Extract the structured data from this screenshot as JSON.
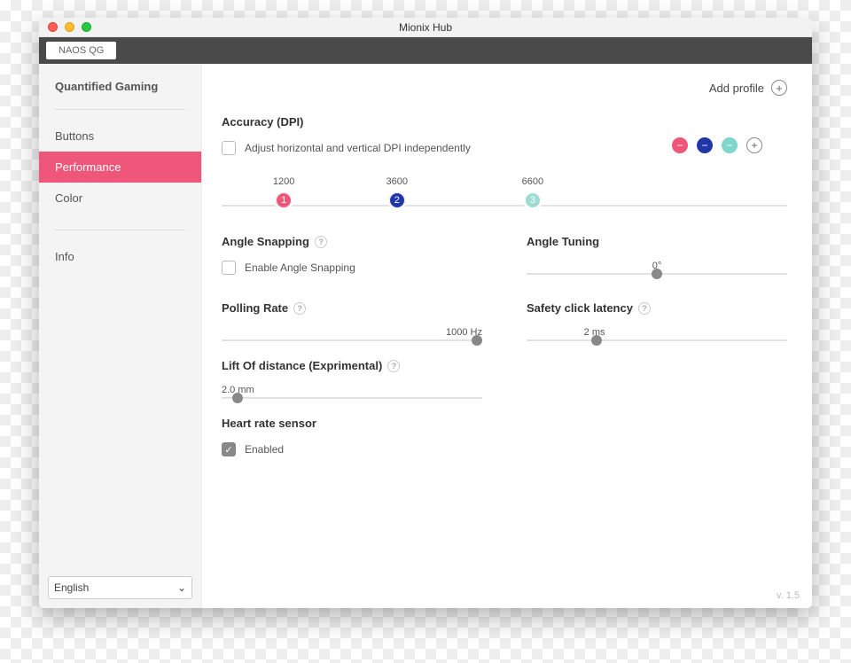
{
  "window": {
    "title": "Mionix Hub"
  },
  "devicebar": {
    "device": "NAOS QG"
  },
  "sidebar": {
    "header": "Quantified Gaming",
    "items": [
      {
        "label": "Buttons",
        "active": false
      },
      {
        "label": "Performance",
        "active": true
      },
      {
        "label": "Color",
        "active": false
      }
    ],
    "info": "Info",
    "language": "English"
  },
  "topbar": {
    "add_profile": "Add profile"
  },
  "accuracy": {
    "title": "Accuracy (DPI)",
    "independent_label": "Adjust horizontal and vertical DPI independently",
    "independent_checked": false,
    "stops": [
      {
        "value": "1200",
        "num": "1",
        "color": "pink",
        "pos_pct": 11
      },
      {
        "value": "3600",
        "num": "2",
        "color": "blue",
        "pos_pct": 31
      },
      {
        "value": "6600",
        "num": "3",
        "color": "teal",
        "pos_pct": 55
      }
    ]
  },
  "angle_snapping": {
    "title": "Angle Snapping",
    "checkbox_label": "Enable Angle Snapping",
    "checked": false
  },
  "angle_tuning": {
    "title": "Angle Tuning",
    "value_label": "0°",
    "thumb_pct": 50
  },
  "polling": {
    "title": "Polling Rate",
    "value_label": "1000 Hz",
    "thumb_pct": 98
  },
  "safety": {
    "title": "Safety click latency",
    "value_label": "2 ms",
    "thumb_pct": 27
  },
  "lod": {
    "title": "Lift Of distance (Exprimental)",
    "value_label": "2.0 mm",
    "thumb_pct": 6
  },
  "heart": {
    "title": "Heart rate sensor",
    "checkbox_label": "Enabled",
    "checked": true
  },
  "footer": {
    "version": "v. 1.5"
  }
}
